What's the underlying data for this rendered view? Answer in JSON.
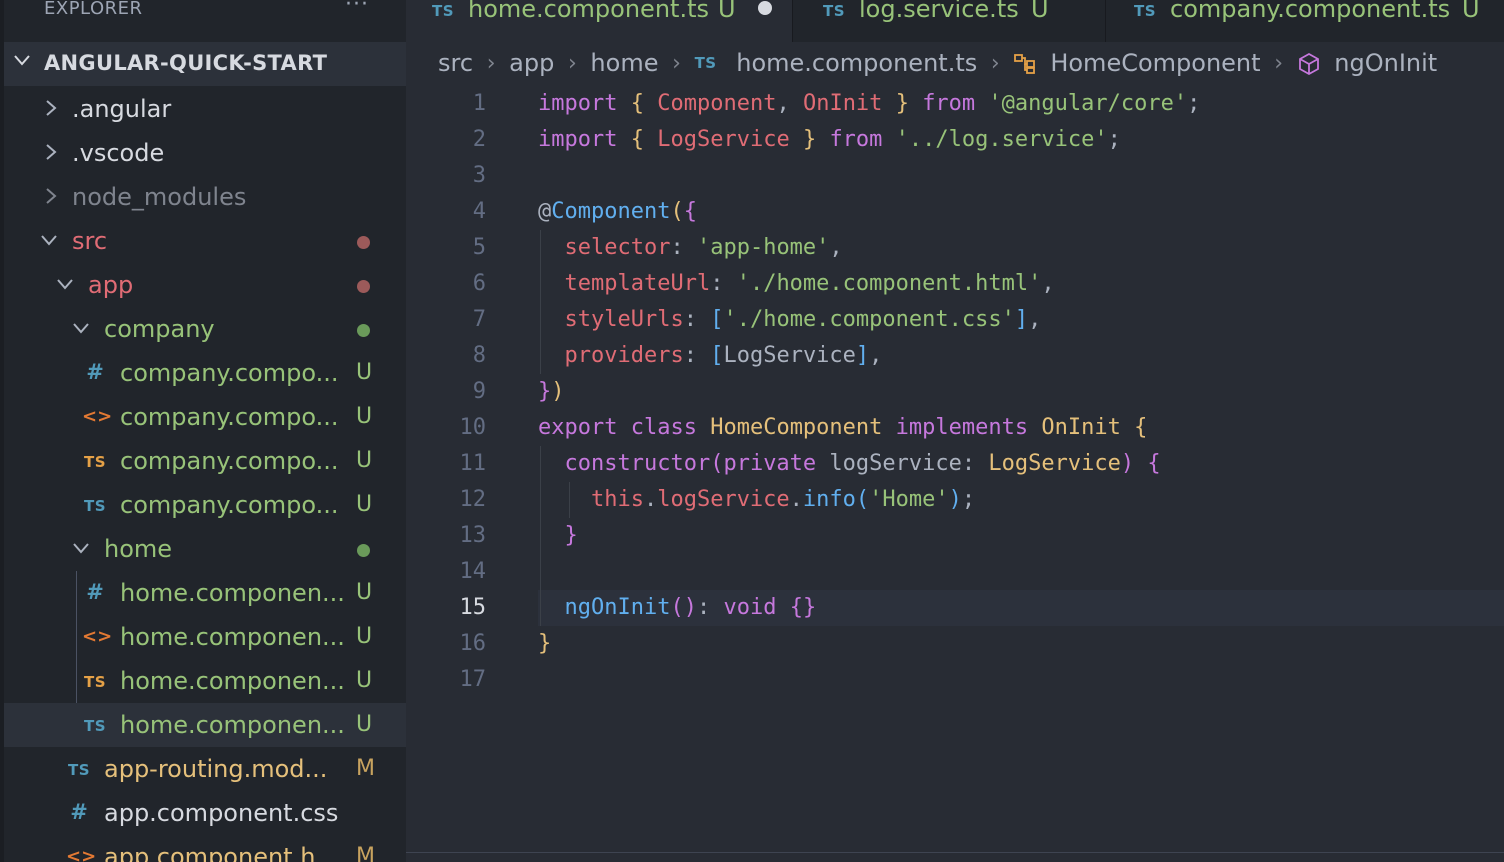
{
  "colors": {
    "git_untracked": "#98c379",
    "git_modified": "#e5c07b",
    "git_conflict_dot": "#b26a6a",
    "ts_icon": "#519aba"
  },
  "sidebar": {
    "header": "EXPLORER",
    "more": "···",
    "project": "ANGULAR-QUICK-START",
    "items": [
      {
        "label": ".angular",
        "icon": "chevron-right"
      },
      {
        "label": ".vscode",
        "icon": "chevron-right"
      },
      {
        "label": "node_modules",
        "icon": "chevron-right"
      },
      {
        "label": "src",
        "icon": "chevron-down"
      },
      {
        "label": "app",
        "icon": "chevron-down"
      },
      {
        "label": "company",
        "icon": "chevron-down"
      },
      {
        "label": "company.compo...",
        "icon": "#",
        "status": "U"
      },
      {
        "label": "company.compo...",
        "icon": "<>",
        "status": "U"
      },
      {
        "label": "company.compo...",
        "icon": "TS",
        "status": "U"
      },
      {
        "label": "company.compo...",
        "icon": "TS",
        "status": "U"
      },
      {
        "label": "home",
        "icon": "chevron-down"
      },
      {
        "label": "home.componen...",
        "icon": "#",
        "status": "U"
      },
      {
        "label": "home.componen...",
        "icon": "<>",
        "status": "U"
      },
      {
        "label": "home.componen...",
        "icon": "TS",
        "status": "U"
      },
      {
        "label": "home.componen...",
        "icon": "TS",
        "status": "U"
      },
      {
        "label": "app-routing.mod...",
        "icon": "TS",
        "status": "M"
      },
      {
        "label": "app.component.css",
        "icon": "#"
      },
      {
        "label": "app.component.h...",
        "icon": "<>",
        "status": "M"
      }
    ]
  },
  "tabs": [
    {
      "icon": "TS",
      "name": "home.component.ts",
      "badge": "U"
    },
    {
      "icon": "TS",
      "name": "log.service.ts",
      "badge": "U"
    },
    {
      "icon": "TS",
      "name": "company.component.ts",
      "badge": "U"
    }
  ],
  "breadcrumb": {
    "parts": [
      "src",
      "app",
      "home"
    ],
    "file_icon": "TS",
    "file": "home.component.ts",
    "class": "HomeComponent",
    "method": "ngOnInit"
  },
  "editor": {
    "line_numbers": [
      "1",
      "2",
      "3",
      "4",
      "5",
      "6",
      "7",
      "8",
      "9",
      "10",
      "11",
      "12",
      "13",
      "14",
      "15",
      "16",
      "17"
    ],
    "active_line": "15",
    "lines": {
      "l1": {
        "kw1": "import",
        "b1": "{",
        "id1": "Component",
        "p1": ",",
        "id2": "OnInit",
        "b2": "}",
        "kw2": "from",
        "str": "'@angular/core'",
        "p2": ";"
      },
      "l2": {
        "kw1": "import",
        "b1": "{",
        "id1": "LogService",
        "b2": "}",
        "kw2": "from",
        "str": "'../log.service'",
        "p2": ";"
      },
      "l4": {
        "at": "@",
        "dec": "Component",
        "b1": "(",
        "b2": "{"
      },
      "l5": {
        "key": "selector",
        "p1": ":",
        "str": "'app-home'",
        "p2": ","
      },
      "l6": {
        "key": "templateUrl",
        "p1": ":",
        "str": "'./home.component.html'",
        "p2": ","
      },
      "l7": {
        "key": "styleUrls",
        "p1": ":",
        "b1": "[",
        "str": "'./home.component.css'",
        "b2": "]",
        "p2": ","
      },
      "l8": {
        "key": "providers",
        "p1": ":",
        "b1": "[",
        "id": "LogService",
        "b2": "]",
        "p2": ","
      },
      "l9": {
        "b1": "}",
        "b2": ")"
      },
      "l10": {
        "kw1": "export",
        "kw2": "class",
        "cls": "HomeComponent",
        "kw3": "implements",
        "iface": "OnInit",
        "b1": "{"
      },
      "l11": {
        "fn": "constructor",
        "b1": "(",
        "kw": "private",
        "param": "logService",
        "p1": ":",
        "type": "LogService",
        "b2": ")",
        "b3": "{"
      },
      "l12": {
        "this": "this",
        "p1": ".",
        "prop": "logService",
        "p2": ".",
        "fn": "info",
        "b1": "(",
        "str": "'Home'",
        "b2": ")",
        "p3": ";"
      },
      "l13": {
        "b1": "}"
      },
      "l15": {
        "fn": "ngOnInit",
        "b1": "()",
        "p1": ":",
        "type": "void",
        "b2": "{}"
      },
      "l16": {
        "b1": "}"
      }
    }
  }
}
